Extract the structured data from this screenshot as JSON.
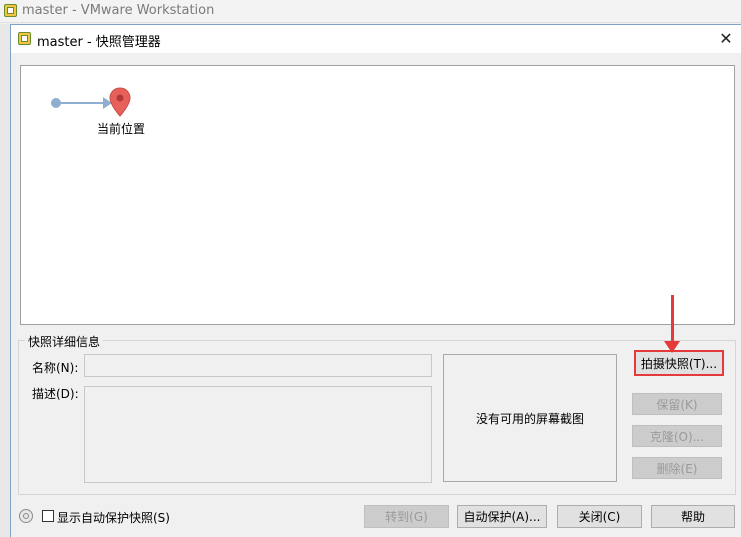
{
  "parent_window": {
    "title": "master - VMware Workstation"
  },
  "dialog": {
    "title": "master - 快照管理器",
    "close_glyph": "✕"
  },
  "tree": {
    "current_location_label": "当前位置"
  },
  "details": {
    "legend": "快照详细信息",
    "name_label": "名称(N):",
    "desc_label": "描述(D):",
    "name_value": "",
    "desc_value": "",
    "no_screenshot": "没有可用的屏幕截图"
  },
  "side_buttons": {
    "take_snapshot": "拍摄快照(T)...",
    "keep": "保留(K)",
    "clone": "克隆(O)...",
    "delete": "删除(E)"
  },
  "bottom": {
    "show_autoprotect": "显示自动保护快照(S)",
    "goto": "转到(G)",
    "autoprotect": "自动保护(A)...",
    "close": "关闭(C)",
    "help": "帮助"
  },
  "colors": {
    "highlight": "#e53a3a",
    "pin": "#e8605a",
    "connector": "#8faed0"
  },
  "icons": [
    "vmware-icon",
    "close-icon",
    "location-pin-icon",
    "autoprotect-hint-icon"
  ]
}
